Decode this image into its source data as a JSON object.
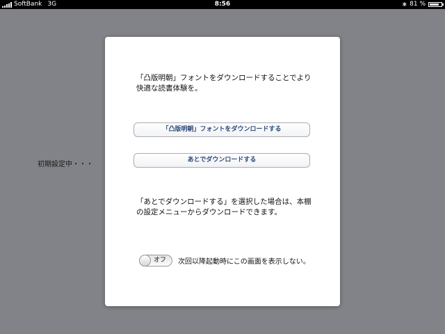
{
  "status_bar": {
    "carrier": "SoftBank",
    "network": "3G",
    "time": "8:56",
    "battery_text": "81 %",
    "battery_level": 0.81,
    "icons": [
      "signal-bars-icon",
      "bluetooth-icon",
      "battery-icon"
    ]
  },
  "background": {
    "status_text": "初期設定中・・・"
  },
  "dialog": {
    "message_line1": "「凸版明朝」フォントをダウンロードすることでより",
    "message_line2": "快適な読書体験を。",
    "download_button": "「凸版明朝」フォントをダウンロードする",
    "later_button": "あとでダウンロードする",
    "note_line1": "「あとでダウンロードする」を選択した場合は、本棚",
    "note_line2": "の設定メニューからダウンロードできます。",
    "toggle_state": "オフ",
    "toggle_label": "次回以降起動時にこの画面を表示しない。"
  },
  "colors": {
    "background": "#828388",
    "button_text": "#2d4a7a",
    "status_bar": "#000000"
  }
}
